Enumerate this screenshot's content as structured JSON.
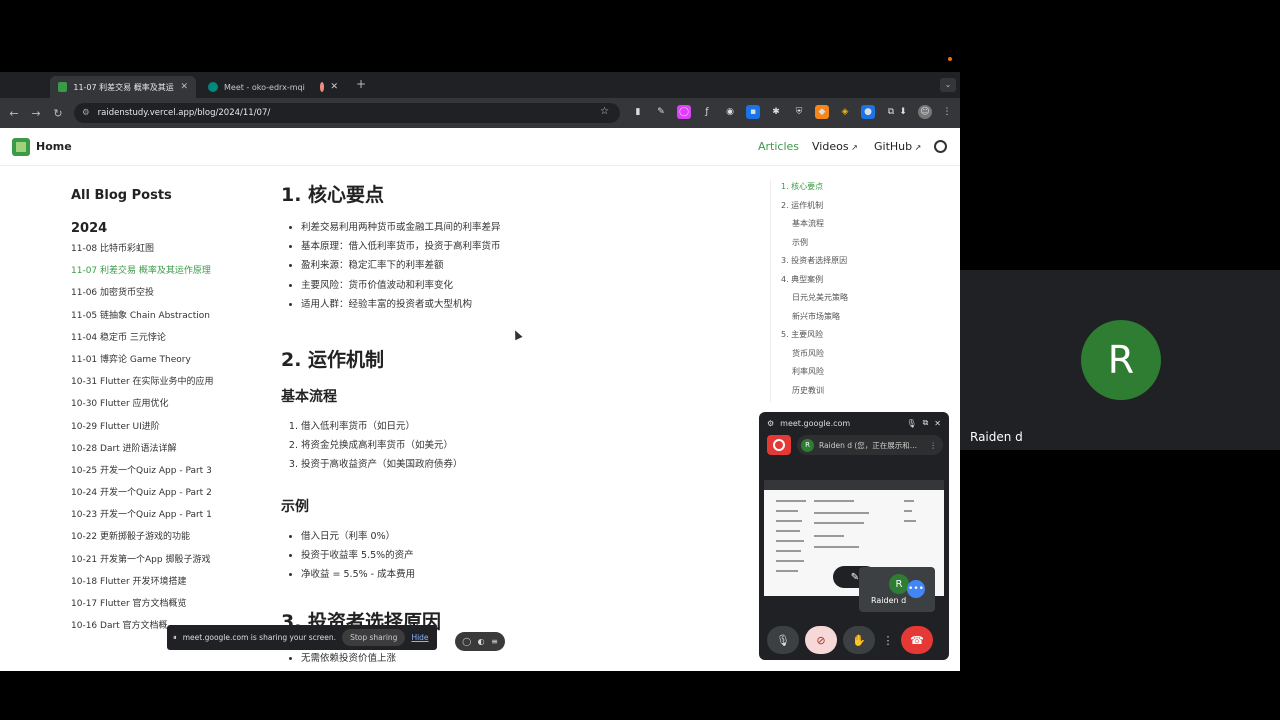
{
  "browser": {
    "tabs": [
      {
        "title": "11-07 利差交易 概率及其运作原"
      },
      {
        "title": "Meet - oko-edrx-mqi"
      },
      {
        "title": ""
      }
    ],
    "url": "raidenstudy.vercel.app/blog/2024/11/07/"
  },
  "site": {
    "home": "Home",
    "nav": {
      "articles": "Articles",
      "videos": "Videos",
      "github": "GitHub"
    }
  },
  "sidebar": {
    "title": "All Blog Posts",
    "year": "2024",
    "posts": [
      "11-08 比特币彩虹图",
      "11-07 利差交易 概率及其运作原理",
      "11-06 加密货币空投",
      "11-05 链抽象 Chain Abstraction",
      "11-04 稳定币 三元悖论",
      "11-01 博弈论 Game Theory",
      "10-31 Flutter 在实际业务中的应用",
      "10-30 Flutter 应用优化",
      "10-29 Flutter UI进阶",
      "10-28 Dart 进阶语法详解",
      "10-25 开发一个Quiz App - Part 3",
      "10-24 开发一个Quiz App - Part 2",
      "10-23 开发一个Quiz App - Part 1",
      "10-22 更新掷骰子游戏的功能",
      "10-21 开发第一个App 掷骰子游戏",
      "10-18 Flutter 开发环境搭建",
      "10-17 Flutter 官方文档概览",
      "10-16 Dart 官方文档概"
    ]
  },
  "article": {
    "s1": {
      "title": "1. 核心要点",
      "items": [
        "利差交易利用两种货币或金融工具间的利率差异",
        "基本原理：借入低利率货币，投资于高利率货币",
        "盈利来源：稳定汇率下的利率差额",
        "主要风险：货币价值波动和利率变化",
        "适用人群：经验丰富的投资者或大型机构"
      ]
    },
    "s2": {
      "title": "2. 运作机制",
      "flow_title": "基本流程",
      "flow": [
        "借入低利率货币（如日元）",
        "将资金兑换成高利率货币（如美元）",
        "投资于高收益资产（如美国政府债券）"
      ],
      "example_title": "示例",
      "example": [
        "借入日元（利率 0%）",
        "投资于收益率 5.5%的资产",
        "净收益 = 5.5% - 成本费用"
      ]
    },
    "s3": {
      "title": "3. 投资者选择原因",
      "items": [
        "无需依赖投资价值上涨"
      ]
    }
  },
  "toc": [
    "1. 核心要点",
    "2. 运作机制",
    "基本流程",
    "示例",
    "3. 投资者选择原因",
    "4. 典型案例",
    "日元兑美元策略",
    "新兴市场策略",
    "5. 主要风险",
    "货币风险",
    "利率风险",
    "历史教训"
  ],
  "sharing": {
    "message": "meet.google.com is sharing your screen.",
    "stop": "Stop sharing",
    "hide": "Hide"
  },
  "meet": {
    "domain": "meet.google.com",
    "presenter": "Raiden d (您，正在展示和...",
    "avatar_letter": "R",
    "tile_name": "Raiden d",
    "participant_name": "Raiden d"
  },
  "colors": {
    "accent": "#3a9b47",
    "end_call": "#e53935",
    "avatar": "#2e7d32"
  }
}
